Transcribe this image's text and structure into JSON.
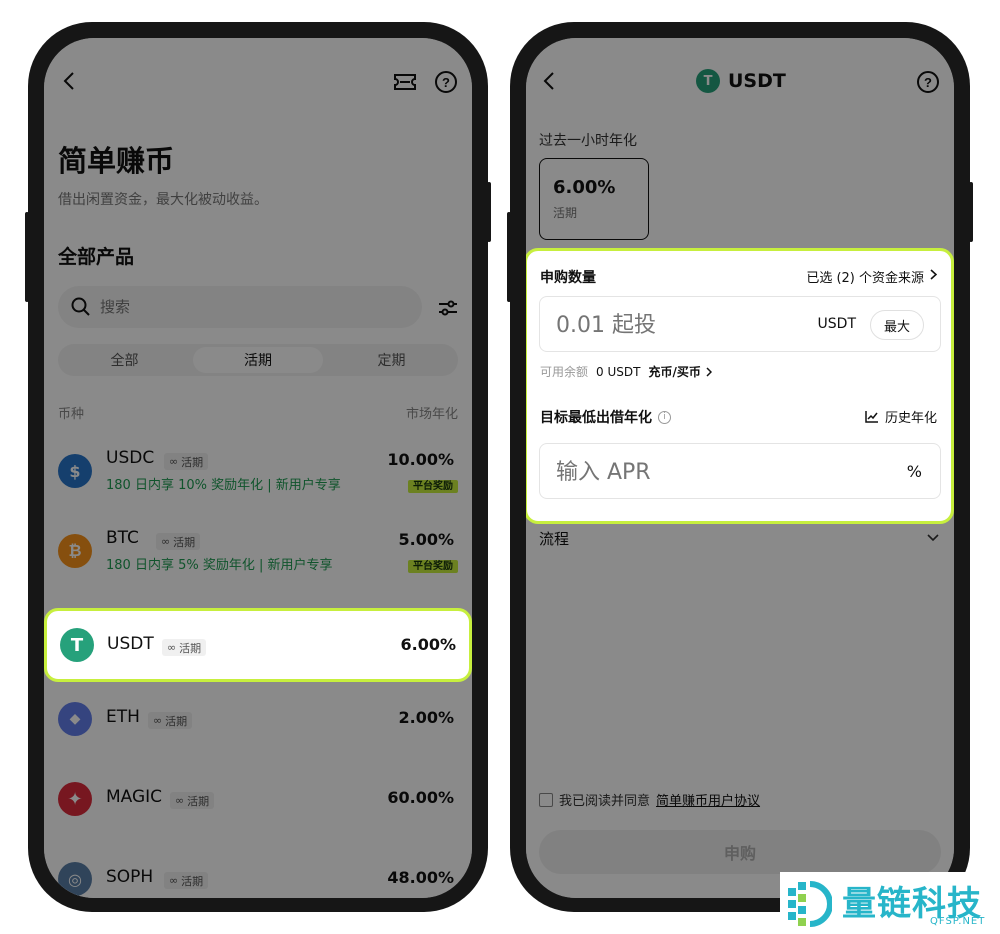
{
  "left": {
    "title": "简单赚币",
    "subtitle": "借出闲置资金，最大化被动收益。",
    "section_title": "全部产品",
    "search_placeholder": "搜索",
    "tabs": [
      "全部",
      "活期",
      "定期"
    ],
    "col_coin": "币种",
    "col_rate": "市场年化",
    "tag_label": "活期",
    "badge_label": "平台奖励",
    "products": [
      {
        "name": "USDC",
        "rate": "10.00%",
        "promo": "180 日内享 10% 奖励年化 | 新用户专享",
        "color": "#2775ca",
        "icon": "usdc-icon",
        "glyph": "$"
      },
      {
        "name": "BTC",
        "rate": "5.00%",
        "promo": "180 日内享 5% 奖励年化 | 新用户专享",
        "color": "#f7931a",
        "icon": "btc-icon",
        "glyph": "₿"
      },
      {
        "name": "USDT",
        "rate": "6.00%",
        "promo": "",
        "color": "#26a17b",
        "icon": "usdt-icon",
        "glyph": "T"
      },
      {
        "name": "ETH",
        "rate": "2.00%",
        "promo": "",
        "color": "#627eea",
        "icon": "eth-icon",
        "glyph": "◆"
      },
      {
        "name": "MAGIC",
        "rate": "60.00%",
        "promo": "",
        "color": "#dc2c3c",
        "icon": "magic-icon",
        "glyph": "✦"
      },
      {
        "name": "SOPH",
        "rate": "48.00%",
        "promo": "",
        "color": "#5a7ea6",
        "icon": "soph-icon",
        "glyph": "◎"
      }
    ]
  },
  "right": {
    "coin": "USDT",
    "apr_label": "过去一小时年化",
    "apr_value": "6.00%",
    "apr_type": "活期",
    "amount_label": "申购数量",
    "source_label": "已选 (2) 个资金来源",
    "amount_placeholder": "0.01 起投",
    "amount_unit": "USDT",
    "max_label": "最大",
    "balance_label": "可用余额",
    "balance_value": "0 USDT",
    "deposit_link": "充币/买币",
    "min_apr_label": "目标最低出借年化",
    "history_label": "历史年化",
    "apr_placeholder": "输入 APR",
    "apr_unit": "%",
    "process_label": "流程",
    "agree_text": "我已阅读并同意",
    "agree_link": "简单赚币用户协议",
    "submit_label": "申购"
  },
  "watermark": {
    "text": "量链科技",
    "sub": "QFSP.NET"
  }
}
